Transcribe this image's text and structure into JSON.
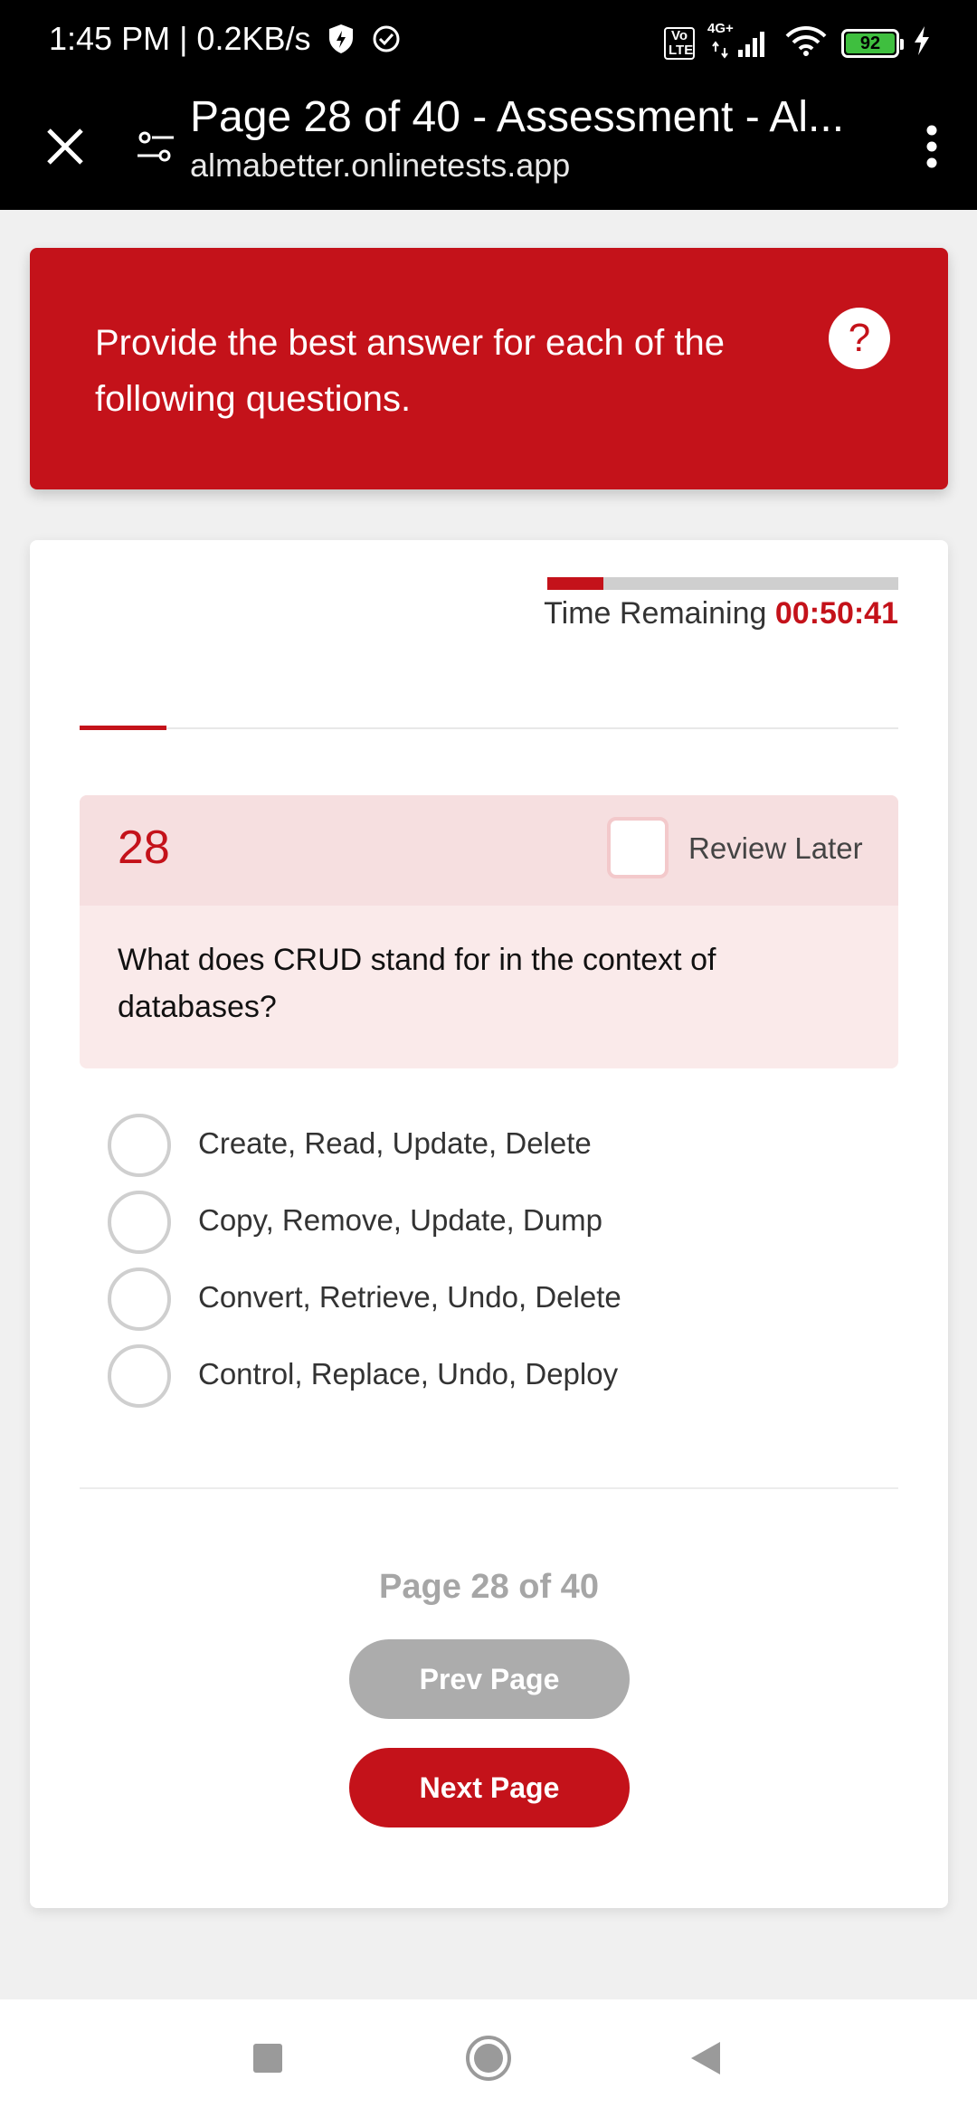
{
  "status_bar": {
    "time_speed": "1:45 PM | 0.2KB/s",
    "volte": "Vo LTE",
    "network": "4G+",
    "battery": "92"
  },
  "browser": {
    "title": "Page 28 of 40 - Assessment - Al...",
    "url": "almabetter.onlinetests.app"
  },
  "banner": {
    "instructions": "Provide the best answer for each of the following questions.",
    "help_symbol": "?"
  },
  "timer": {
    "label": "Time Remaining",
    "value": "00:50:41",
    "fraction_elapsed": 0.16
  },
  "section_progress": {
    "fraction": 0.106
  },
  "question": {
    "number": "28",
    "review_label": "Review Later",
    "text": "What does CRUD stand for in the context of databases?",
    "options": [
      "Create, Read, Update, Delete",
      "Copy, Remove, Update, Dump",
      "Convert, Retrieve, Undo, Delete",
      "Control, Replace, Undo, Deploy"
    ]
  },
  "pagination": {
    "indicator": "Page 28 of 40",
    "prev_label": "Prev Page",
    "next_label": "Next Page"
  },
  "colors": {
    "brand": "#c4121a",
    "disabled": "#acacac"
  },
  "nav": {
    "icons": [
      "recents-icon",
      "home-icon",
      "back-icon"
    ]
  }
}
